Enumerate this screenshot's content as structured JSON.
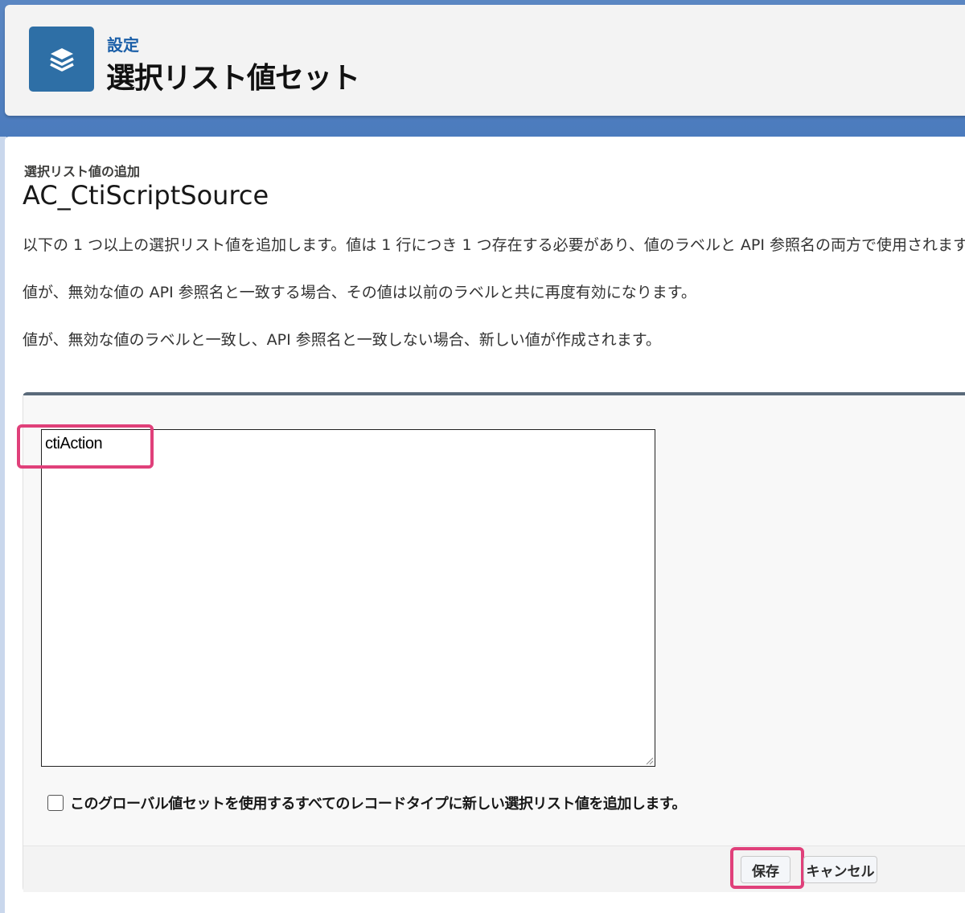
{
  "header": {
    "kicker": "設定",
    "title": "選択リスト値セット",
    "icon": "layers-icon"
  },
  "main": {
    "sub_kicker": "選択リスト値の追加",
    "sub_title": "AC_CtiScriptSource",
    "descriptions": [
      "以下の 1 つ以上の選択リスト値を追加します。値は 1 行につき 1 つ存在する必要があり、値のラベルと API 参照名の両方で使用されます",
      "値が、無効な値の API 参照名と一致する場合、その値は以前のラベルと共に再度有効になります。",
      "値が、無効な値のラベルと一致し、API 参照名と一致しない場合、新しい値が作成されます。"
    ]
  },
  "form": {
    "textarea_value": "ctiAction",
    "checkbox_label": "このグローバル値セットを使用するすべてのレコードタイプに新しい選択リスト値を追加します。",
    "checkbox_checked": false,
    "save_label": "保存",
    "cancel_label": "キャンセル"
  },
  "colors": {
    "highlight": "#e0407a",
    "header_icon_bg": "#2e6fa6",
    "kicker": "#1b5fa8"
  }
}
